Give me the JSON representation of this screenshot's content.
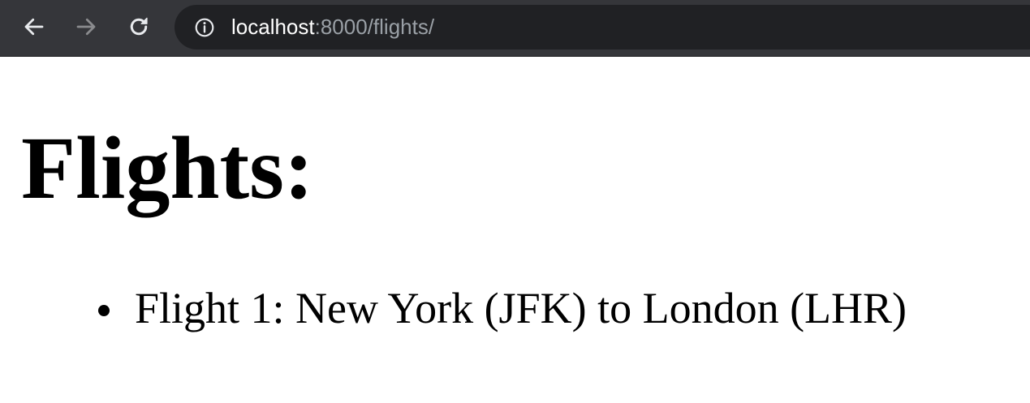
{
  "browser": {
    "url_host": "localhost",
    "url_rest": ":8000/flights/",
    "icons": {
      "back": "back-arrow-icon",
      "forward": "forward-arrow-icon",
      "reload": "reload-icon",
      "info": "info-icon"
    },
    "colors": {
      "toolbar": "#35363a",
      "omnibox": "#202124",
      "url_host": "#ffffff",
      "url_rest": "#9aa0a6"
    }
  },
  "page": {
    "title": "Flights:",
    "flights": [
      {
        "label": "Flight 1: New York (JFK) to London (LHR)"
      }
    ]
  }
}
